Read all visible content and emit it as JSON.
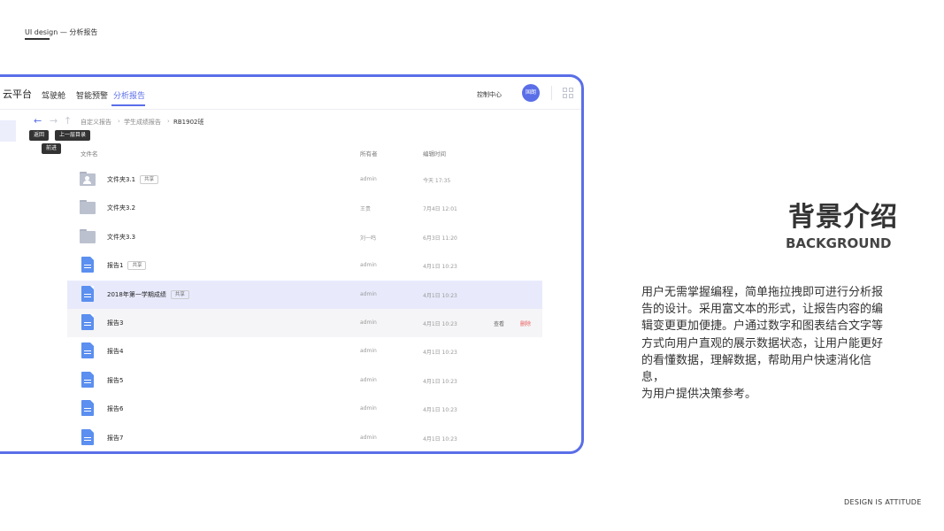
{
  "page": {
    "top_label": "UI design — 分析报告",
    "footer": "DESIGN   IS   ATTITUDE"
  },
  "app": {
    "brand": "云平台",
    "nav": [
      "驾驶舱",
      "智能预警",
      "分析报告"
    ],
    "active_nav": 2,
    "control_center": "控制中心",
    "avatar_text": "国朗"
  },
  "toolbar": {
    "breadcrumb": [
      "自定义报告",
      "学生成绩报告",
      "RB1902班"
    ],
    "separator": "›",
    "tooltips": {
      "back": "返回",
      "forward": "前进",
      "up": "上一层目录"
    }
  },
  "table": {
    "headers": {
      "name": "文件名",
      "owner": "所有者",
      "time": "编辑时间"
    },
    "rows": [
      {
        "type": "folder-user",
        "name": "文件夹3.1",
        "tag": "共享",
        "owner": "admin",
        "time": "今天 17:35"
      },
      {
        "type": "folder",
        "name": "文件夹3.2",
        "tag": "",
        "owner": "王贵",
        "time": "7月4日 12:01"
      },
      {
        "type": "folder",
        "name": "文件夹3.3",
        "tag": "",
        "owner": "刘一鸣",
        "time": "6月3日 11:20"
      },
      {
        "type": "doc",
        "name": "报告1",
        "tag": "共享",
        "owner": "admin",
        "time": "4月1日 10:23"
      },
      {
        "type": "doc",
        "name": "2018年第一学期成绩",
        "tag": "共享",
        "owner": "admin",
        "time": "4月1日 10:23",
        "state": "highlight"
      },
      {
        "type": "doc",
        "name": "报告3",
        "tag": "",
        "owner": "admin",
        "time": "4月1日 10:23",
        "state": "hover",
        "actions": [
          "查看",
          "删除"
        ]
      },
      {
        "type": "doc",
        "name": "报告4",
        "tag": "",
        "owner": "admin",
        "time": "4月1日 10:23"
      },
      {
        "type": "doc",
        "name": "报告5",
        "tag": "",
        "owner": "admin",
        "time": "4月1日 10:23"
      },
      {
        "type": "doc",
        "name": "报告6",
        "tag": "",
        "owner": "admin",
        "time": "4月1日 10:23"
      },
      {
        "type": "doc",
        "name": "报告7",
        "tag": "",
        "owner": "admin",
        "time": "4月1日 10:23"
      }
    ]
  },
  "intro": {
    "title_cn": "背景介绍",
    "title_en": "BACKGROUND",
    "lines": [
      "用户无需掌握编程，简单拖拉拽即可进行分析报",
      "告的设计。采用富文本的形式，让报告内容的编",
      "辑变更更加便捷。户通过数字和图表结合文字等",
      "方式向用户直观的展示数据状态，让用户能更好",
      "的看懂数据，理解数据，帮助用户快速消化信息，",
      "为用户提供决策参考。"
    ]
  },
  "colors": {
    "accent": "#5a6ee8",
    "delete": "#e85a5a",
    "doc_icon": "#5b8ff0",
    "folder_icon": "#bcc1cf"
  },
  "icons": {
    "back": "arrow-left-icon",
    "forward": "arrow-right-icon",
    "up": "arrow-up-icon",
    "apps": "grid-icon"
  }
}
